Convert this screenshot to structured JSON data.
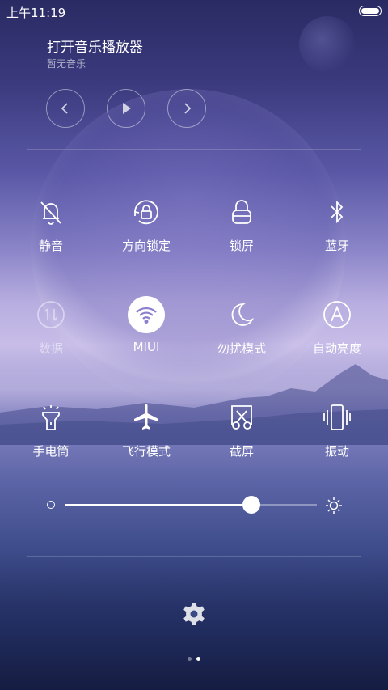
{
  "status_bar": {
    "time": "上午11:19"
  },
  "music": {
    "title": "打开音乐播放器",
    "subtitle": "暂无音乐",
    "controls": [
      "chevron-left-icon",
      "play-icon",
      "chevron-right-icon"
    ]
  },
  "toggles": [
    {
      "label": "静音",
      "icon": "bell-off-icon",
      "state": "normal"
    },
    {
      "label": "方向锁定",
      "icon": "rotation-lock-icon",
      "state": "normal"
    },
    {
      "label": "锁屏",
      "icon": "lock-icon",
      "state": "normal"
    },
    {
      "label": "蓝牙",
      "icon": "bluetooth-icon",
      "state": "normal"
    },
    {
      "label": "数据",
      "icon": "mobile-data-icon",
      "state": "disabled"
    },
    {
      "label": "MIUI",
      "icon": "wifi-icon",
      "state": "active"
    },
    {
      "label": "勿扰模式",
      "icon": "moon-icon",
      "state": "normal"
    },
    {
      "label": "自动亮度",
      "icon": "auto-brightness-icon",
      "state": "normal"
    },
    {
      "label": "手电筒",
      "icon": "flashlight-icon",
      "state": "normal"
    },
    {
      "label": "飞行模式",
      "icon": "airplane-icon",
      "state": "normal"
    },
    {
      "label": "截屏",
      "icon": "screenshot-icon",
      "state": "normal"
    },
    {
      "label": "振动",
      "icon": "vibrate-icon",
      "state": "normal"
    }
  ],
  "brightness": {
    "level": 0.74
  },
  "pagination": {
    "total": 2,
    "current": 2
  },
  "colors": {
    "accent": "#ffffff",
    "active_icon": "#8a7fd0"
  }
}
